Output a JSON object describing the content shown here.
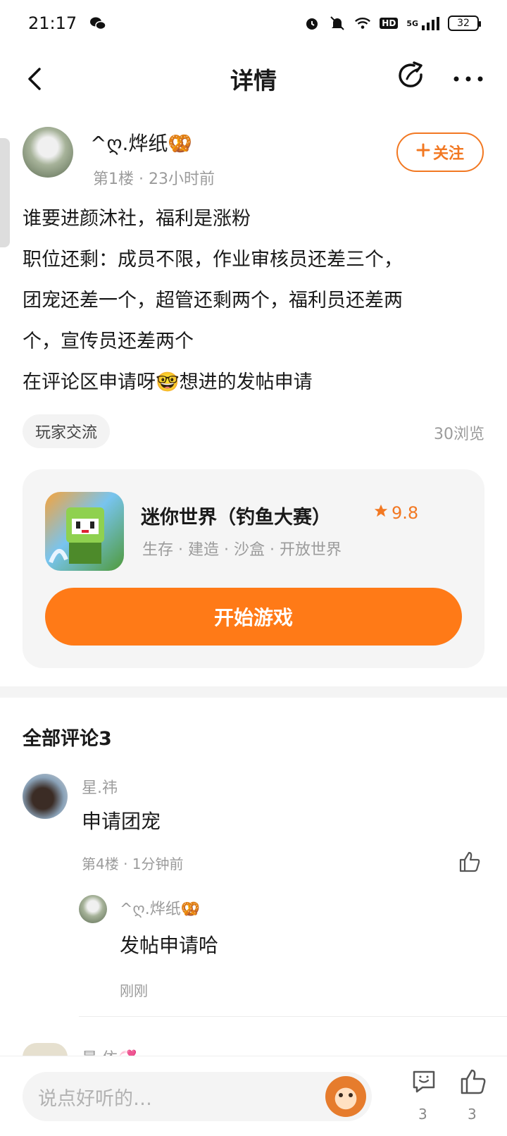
{
  "status_bar": {
    "time": "21:17",
    "battery": "32",
    "network": "5G",
    "hd": "HD"
  },
  "header": {
    "title": "详情"
  },
  "post": {
    "author_name": "^ღ.烨纸🥨",
    "meta": "第1楼 · 23小时前",
    "follow_label": "关注",
    "lines": [
      "谁要进颜沐社，福利是涨粉",
      "职位还剩：成员不限，作业审核员还差三个，",
      "团宠还差一个，超管还剩两个，福利员还差两",
      "个，宣传员还差两个",
      "在评论区申请呀🤓想进的发帖申请"
    ],
    "tag": "玩家交流",
    "views": "30浏览"
  },
  "game": {
    "name": "迷你世界（钓鱼大赛）",
    "rating": "9.8",
    "tags": "生存 · 建造 · 沙盒 · 开放世界",
    "start_label": "开始游戏"
  },
  "comments": {
    "title": "全部评论3",
    "items": [
      {
        "name": "星.祎",
        "text": "申请团宠",
        "meta": "第4楼 · 1分钟前",
        "reply": {
          "name": "^ღ.烨纸🥨",
          "text": "发帖申请哈",
          "meta": "刚刚"
        }
      },
      {
        "name": "晨·依💞"
      }
    ]
  },
  "bottom_bar": {
    "placeholder": "说点好听的…",
    "comment_count": "3",
    "like_count": "3"
  },
  "colors": {
    "accent": "#ff7a17",
    "muted": "#9b9b9b"
  }
}
